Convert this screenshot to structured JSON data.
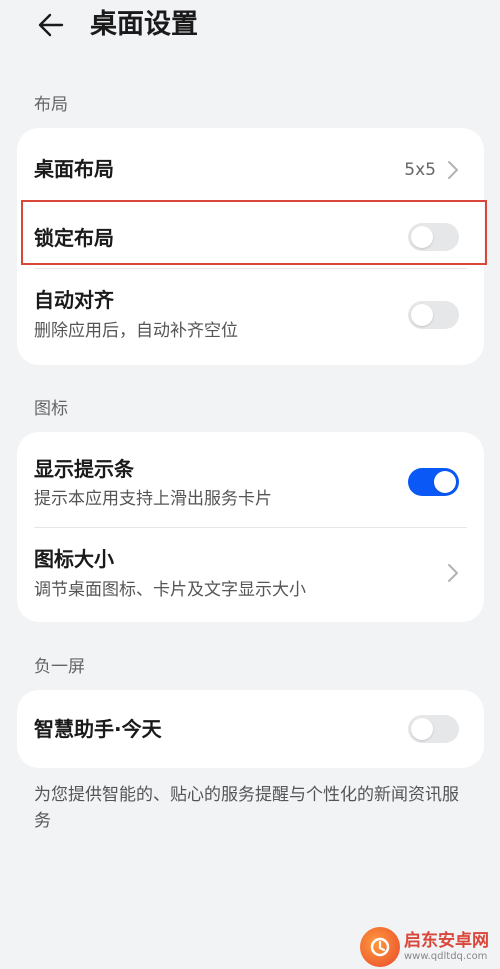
{
  "header": {
    "title": "桌面设置",
    "back_icon": "arrow-left-icon"
  },
  "sections": {
    "layout": {
      "label": "布局",
      "desktop_layout": {
        "title": "桌面布局",
        "value": "5x5"
      },
      "lock_layout": {
        "title": "锁定布局",
        "enabled": false
      },
      "auto_align": {
        "title": "自动对齐",
        "subtitle": "删除应用后，自动补齐空位",
        "enabled": false
      }
    },
    "icons": {
      "label": "图标",
      "show_hint_bar": {
        "title": "显示提示条",
        "subtitle": "提示本应用支持上滑出服务卡片",
        "enabled": true
      },
      "icon_size": {
        "title": "图标大小",
        "subtitle": "调节桌面图标、卡片及文字显示大小"
      }
    },
    "minus_one_screen": {
      "label": "负一屏",
      "smart_assistant": {
        "title": "智慧助手·今天",
        "enabled": false
      }
    }
  },
  "footer": {
    "description": "为您提供智能的、贴心的服务提醒与个性化的新闻资讯服务"
  },
  "watermark": {
    "name": "启东安卓网",
    "url": "www.qdltdq.com"
  },
  "colors": {
    "accent": "#0a59f7",
    "highlight": "#d9473a",
    "background": "#f1f3f5"
  }
}
